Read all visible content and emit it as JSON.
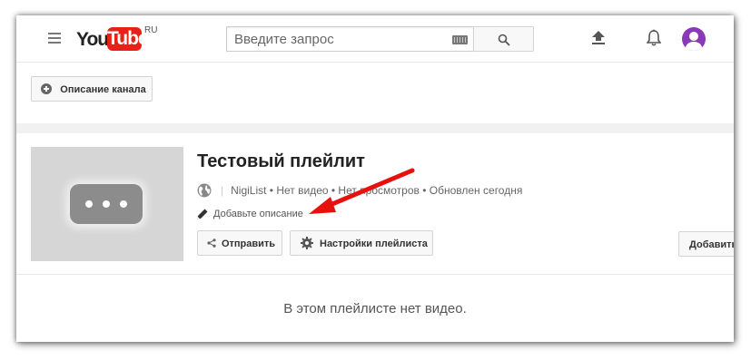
{
  "header": {
    "logo_you": "You",
    "logo_tube": "Tube",
    "logo_region": "RU",
    "search_placeholder": "Введите запрос"
  },
  "channel_bar": {
    "description_button": "Описание канала"
  },
  "playlist": {
    "title": "Тестовый плейлит",
    "separator": "|",
    "meta": "NigiList • Нет видео • Нет просмотров • Обновлен сегодня",
    "add_description": "Добавьте описание",
    "share_button": "Отправить",
    "settings_button": "Настройки плейлиста",
    "add_videos_button": "Добавить",
    "empty_message": "В этом плейлисте нет видео."
  },
  "colors": {
    "brand_red": "#e62117",
    "avatar": "#8a3ab9",
    "annotation_arrow": "#e8100c"
  }
}
